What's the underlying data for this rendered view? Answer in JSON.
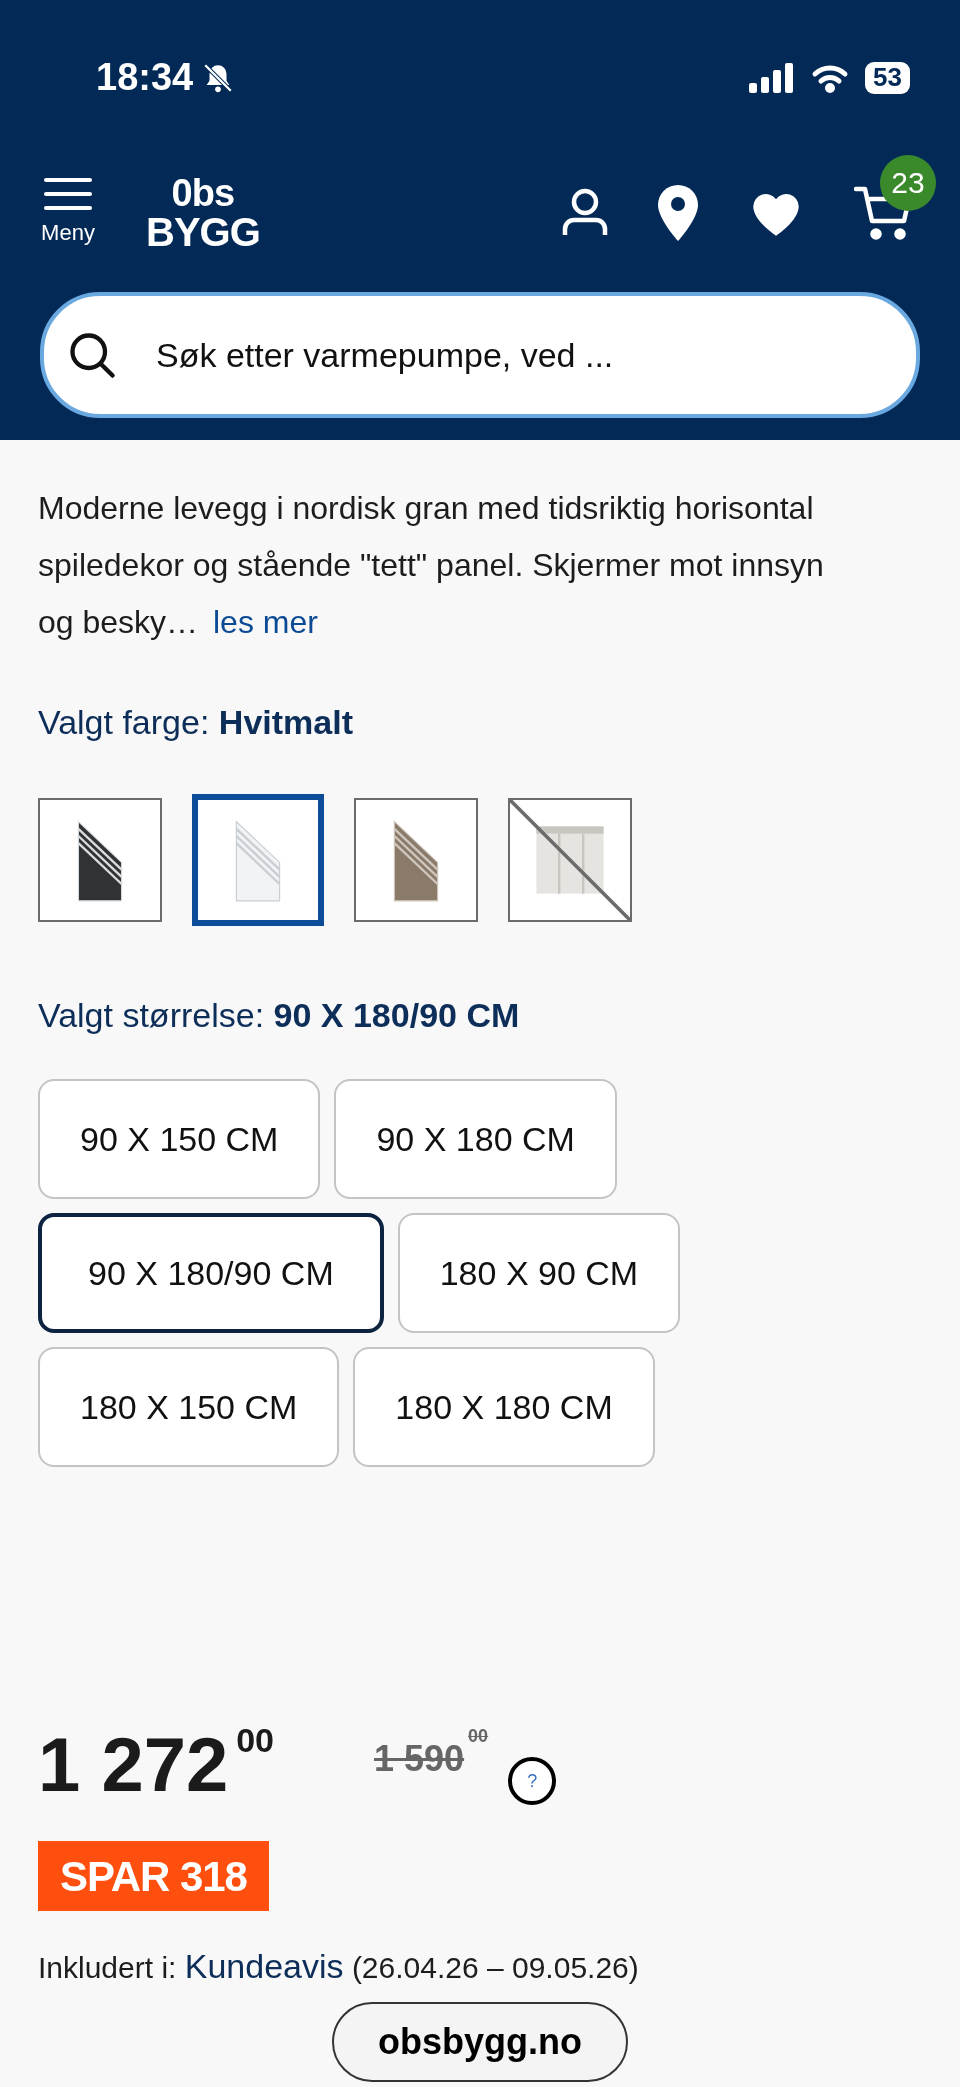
{
  "status_bar": {
    "time": "18:34",
    "battery": "53"
  },
  "header": {
    "menu_label": "Meny",
    "logo_top": "0bs",
    "logo_bottom": "BYGG",
    "cart_count": "23"
  },
  "search": {
    "placeholder": "Søk etter varmepumpe, ved ..."
  },
  "description": {
    "text": "Moderne levegg i nordisk gran med tidsriktig horisontal spiledekor og stående \"tett\" panel. Skjermer mot innsyn og besky…",
    "more_link": "les mer"
  },
  "color_picker": {
    "label": "Valgt farge:",
    "value": "Hvitmalt",
    "swatches": [
      {
        "kind": "picture",
        "selected": false,
        "unavailable": false
      },
      {
        "kind": "picture",
        "selected": true,
        "unavailable": false
      },
      {
        "kind": "picture",
        "selected": false,
        "unavailable": false
      },
      {
        "kind": "picture",
        "selected": false,
        "unavailable": true
      }
    ]
  },
  "size_picker": {
    "label": "Valgt størrelse:",
    "value": "90 X 180/90 CM",
    "rows": [
      [
        {
          "label": "90 X 150 CM",
          "selected": false
        },
        {
          "label": "90 X 180 CM",
          "selected": false
        }
      ],
      [
        {
          "label": "90 X 180/90 CM",
          "selected": true
        },
        {
          "label": "180 X 90 CM",
          "selected": false
        }
      ],
      [
        {
          "label": "180 X 150 CM",
          "selected": false
        },
        {
          "label": "180 X 180 CM",
          "selected": false
        }
      ]
    ]
  },
  "price": {
    "amount": "1 272",
    "cents": "00",
    "old_amount": "1 590",
    "old_cents": "00",
    "help": "?",
    "savings": "SPAR 318"
  },
  "included": {
    "label": "Inkludert i:",
    "link": "Kundeavis",
    "period": "(26.04.26 – 09.05.26)"
  },
  "url_pill": "obsbygg.no"
}
